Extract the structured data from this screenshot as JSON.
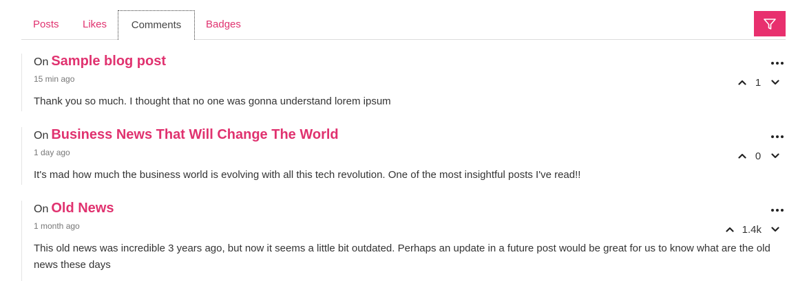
{
  "tabs": [
    {
      "label": "Posts",
      "active": false
    },
    {
      "label": "Likes",
      "active": false
    },
    {
      "label": "Comments",
      "active": true
    },
    {
      "label": "Badges",
      "active": false
    }
  ],
  "filter": {
    "icon": "filter-icon"
  },
  "colors": {
    "accent": "#e8306e",
    "link": "#e0326f"
  },
  "comments": [
    {
      "on_prefix": "On",
      "post_title": "Sample blog post",
      "time": "15 min ago",
      "score": "1",
      "text": "Thank you so much. I thought that no one was gonna understand lorem ipsum"
    },
    {
      "on_prefix": "On",
      "post_title": "Business News That Will Change The World",
      "time": "1 day ago",
      "score": "0",
      "text": "It's mad how much the business world is evolving with all this tech revolution. One of the most insightful posts I've read!!"
    },
    {
      "on_prefix": "On",
      "post_title": "Old News",
      "time": "1 month ago",
      "score": "1.4k",
      "text": "This old news was incredible 3 years ago, but now it seems a little bit outdated. Perhaps an update in a future post would be great for us to know what are the old news these days"
    }
  ]
}
